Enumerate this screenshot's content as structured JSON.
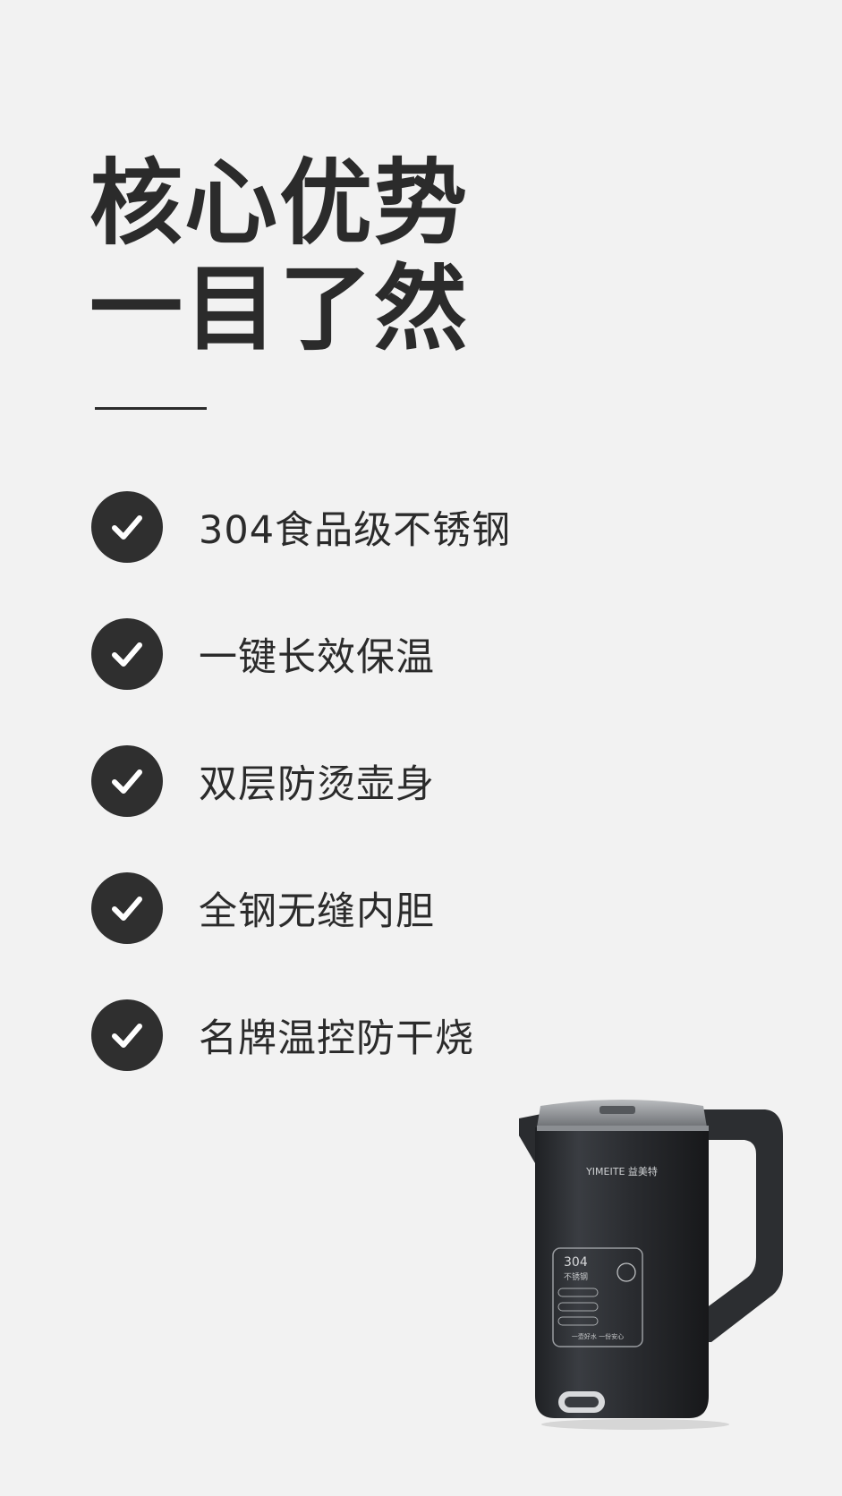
{
  "headline": {
    "line1": "核心优势",
    "line2": "一目了然"
  },
  "features": [
    {
      "label": "304食品级不锈钢",
      "icon": "check-icon"
    },
    {
      "label": "一键长效保温",
      "icon": "check-icon"
    },
    {
      "label": "双层防烫壶身",
      "icon": "check-icon"
    },
    {
      "label": "全钢无缝内胆",
      "icon": "check-icon"
    },
    {
      "label": "名牌温控防干烧",
      "icon": "check-icon"
    }
  ],
  "product": {
    "brand": "YIMEITE 益美特",
    "panel_number": "304",
    "panel_text": "不锈钢",
    "panel_slogan": "一壶好水 一份安心"
  },
  "colors": {
    "background": "#f2f2f2",
    "text": "#2b2b2b",
    "check_circle": "#2f2f2f",
    "kettle_body": "#2d2f33"
  }
}
